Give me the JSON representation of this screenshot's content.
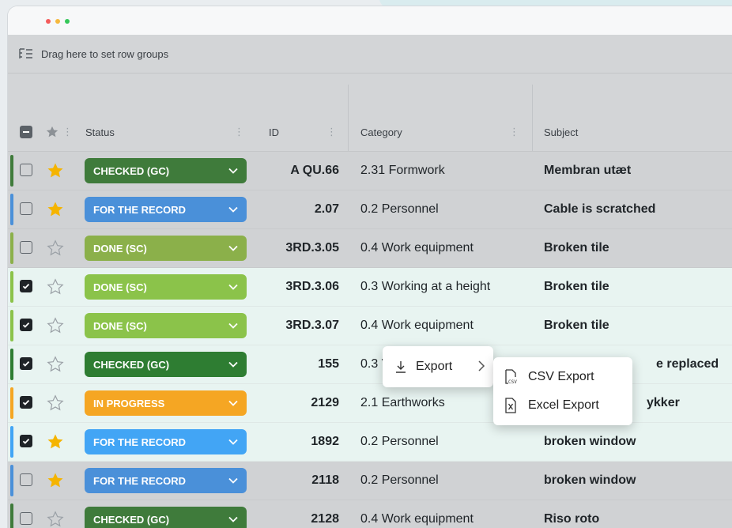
{
  "groupbar": {
    "text": "Drag here to set row groups"
  },
  "columns": {
    "status": "Status",
    "id": "ID",
    "category": "Category",
    "subject": "Subject"
  },
  "status_colors": {
    "CHECKED (GC)": "#3f7b3b",
    "FOR THE RECORD": "#4a90d9",
    "DONE (SC)": "#8bc34a",
    "IN PROGRESS": "#f5a623"
  },
  "rows": [
    {
      "checked": false,
      "starred": true,
      "status": "CHECKED (GC)",
      "color": "#3f7b3b",
      "id": "A QU.66",
      "category": "2.31 Formwork",
      "subject": "Membran utæt",
      "state": "gray"
    },
    {
      "checked": false,
      "starred": true,
      "status": "FOR THE RECORD",
      "color": "#4a90d9",
      "id": "2.07",
      "category": "0.2 Personnel",
      "subject": "Cable is scratched",
      "state": "gray"
    },
    {
      "checked": false,
      "starred": false,
      "status": "DONE (SC)",
      "color": "#8bb04a",
      "id": "3RD.3.05",
      "category": "0.4 Work equipment",
      "subject": "Broken tile",
      "state": "gray"
    },
    {
      "checked": true,
      "starred": false,
      "status": "DONE (SC)",
      "color": "#8bc34a",
      "id": "3RD.3.06",
      "category": "0.3 Working at a height",
      "subject": "Broken tile",
      "state": "sel"
    },
    {
      "checked": true,
      "starred": false,
      "status": "DONE (SC)",
      "color": "#8bc34a",
      "id": "3RD.3.07",
      "category": "0.4 Work equipment",
      "subject": "Broken tile",
      "state": "sel"
    },
    {
      "checked": true,
      "starred": false,
      "status": "CHECKED (GC)",
      "color": "#2e7d32",
      "id": "155",
      "category": "0.3 V",
      "subject": "e replaced",
      "state": "sel"
    },
    {
      "checked": true,
      "starred": false,
      "status": "IN PROGRESS",
      "color": "#f5a623",
      "id": "2129",
      "category": "2.1 Earthworks",
      "subject": "ykker",
      "state": "sel"
    },
    {
      "checked": true,
      "starred": true,
      "status": "FOR THE RECORD",
      "color": "#42a5f5",
      "id": "1892",
      "category": "0.2 Personnel",
      "subject": "broken window",
      "state": "sel"
    },
    {
      "checked": false,
      "starred": true,
      "status": "FOR THE RECORD",
      "color": "#4a90d9",
      "id": "2118",
      "category": "0.2 Personnel",
      "subject": "broken window",
      "state": "gray"
    },
    {
      "checked": false,
      "starred": false,
      "status": "CHECKED (GC)",
      "color": "#3f7b3b",
      "id": "2128",
      "category": "0.4 Work equipment",
      "subject": "Riso roto",
      "state": "gray"
    }
  ],
  "context_menu": {
    "export": "Export"
  },
  "submenu": {
    "csv": "CSV Export",
    "excel": "Excel Export"
  }
}
